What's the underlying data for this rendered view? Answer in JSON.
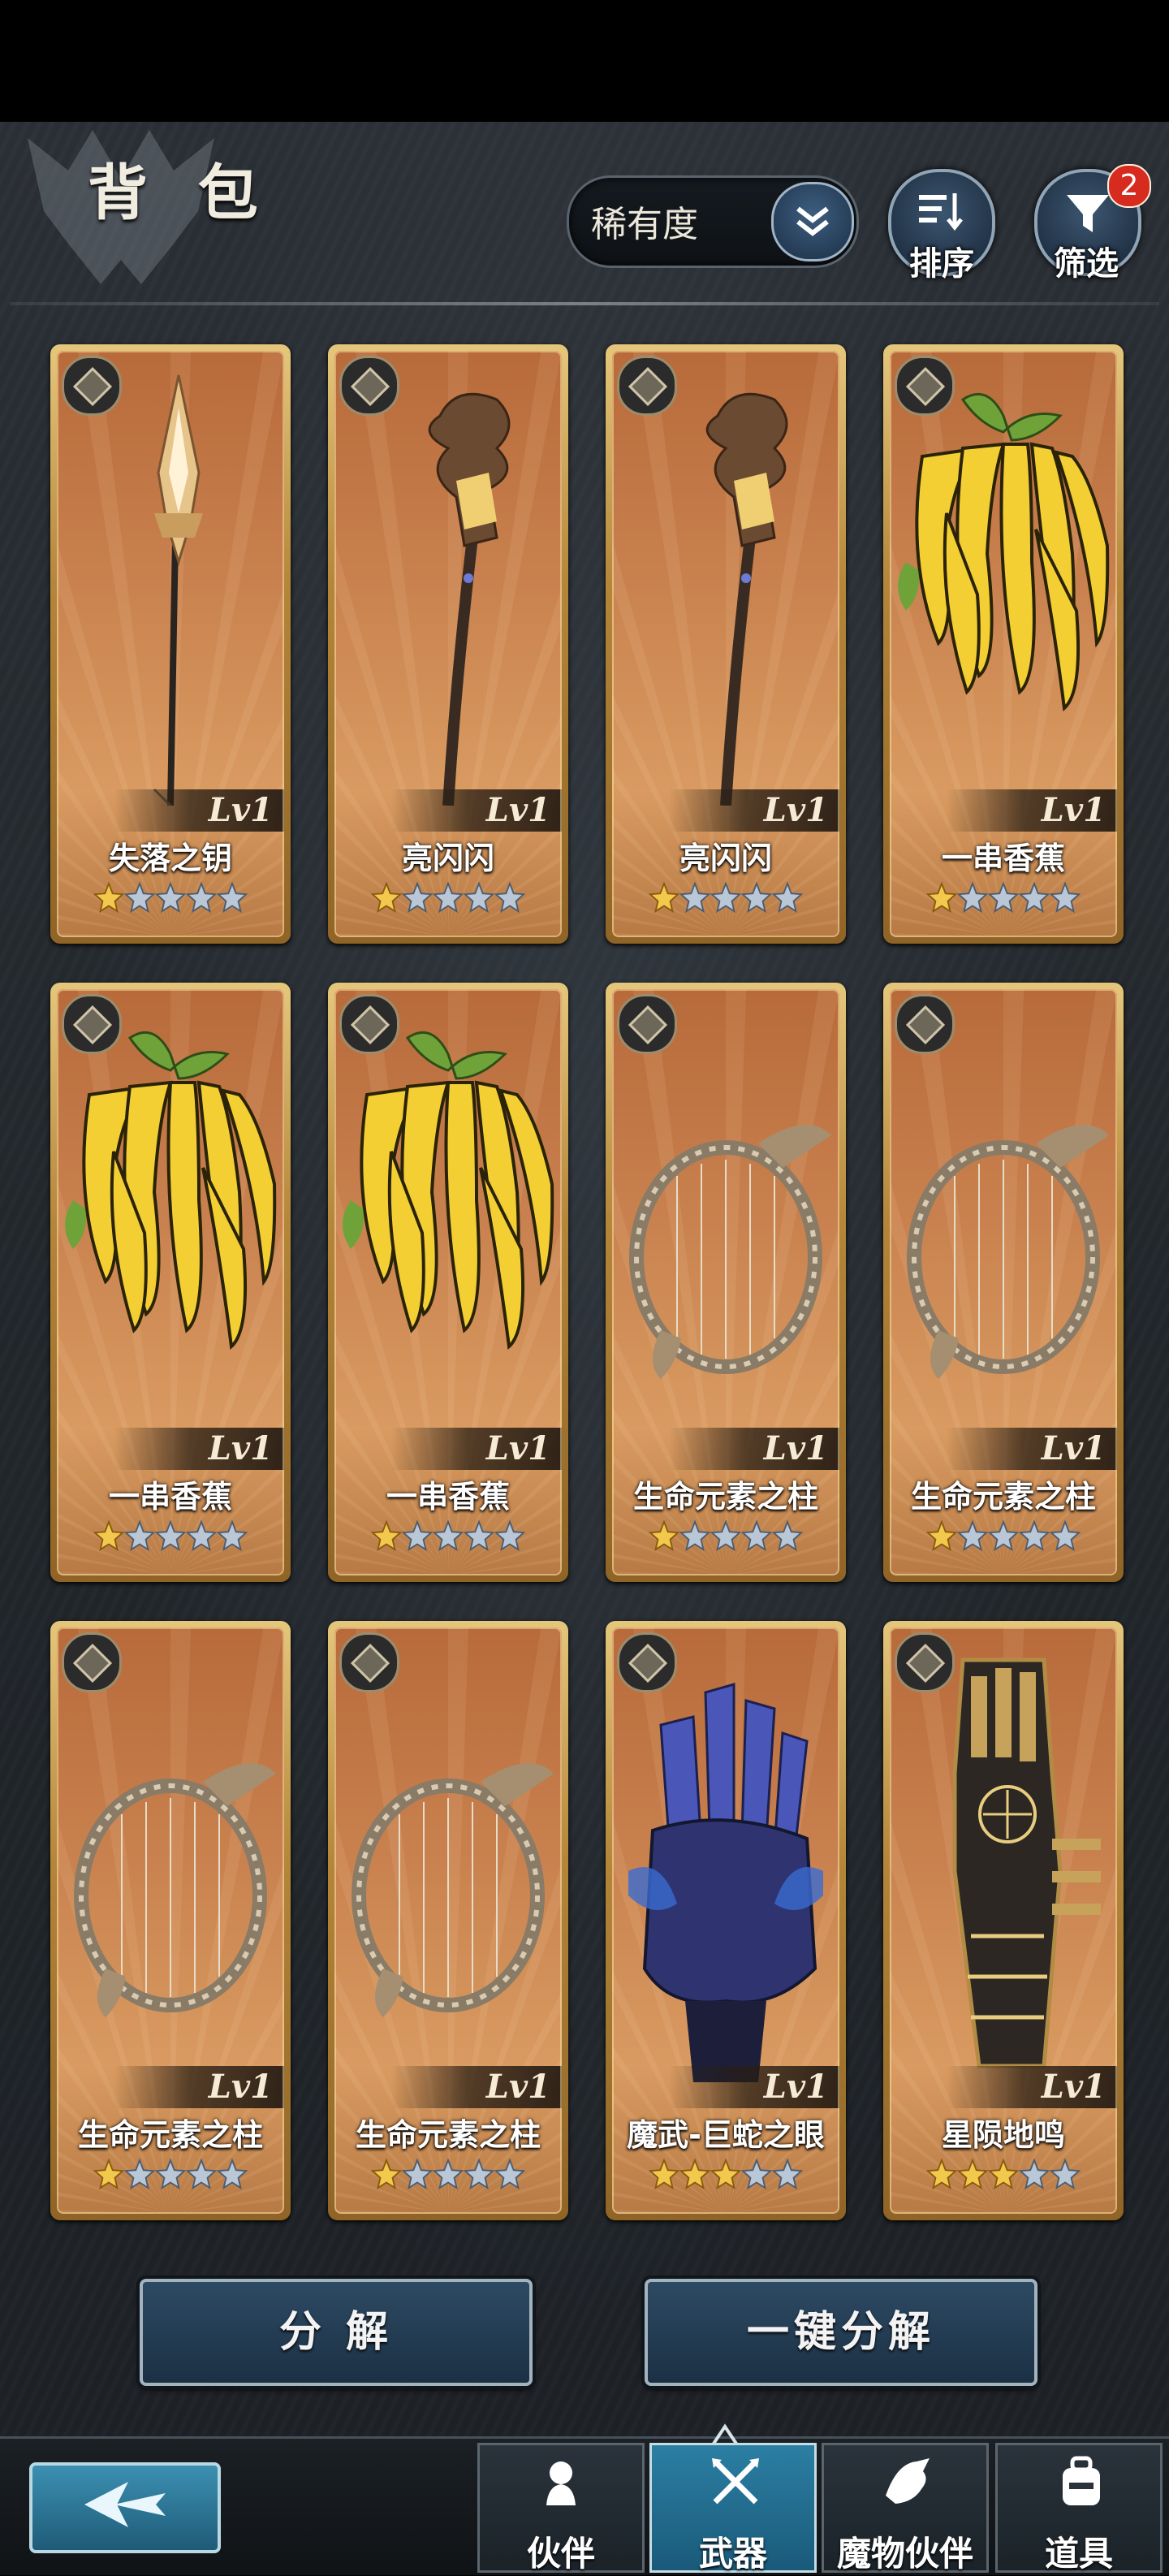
{
  "header": {
    "title": "背 包",
    "rarity_filter": "稀有度",
    "sort_label": "排序",
    "filter_label": "筛选",
    "filter_badge": "2"
  },
  "items": [
    {
      "name": "失落之钥",
      "level": "Lv1",
      "stars": 1,
      "max_stars": 5,
      "art": "spear"
    },
    {
      "name": "亮闪闪",
      "level": "Lv1",
      "stars": 1,
      "max_stars": 5,
      "art": "staff"
    },
    {
      "name": "亮闪闪",
      "level": "Lv1",
      "stars": 1,
      "max_stars": 5,
      "art": "staff"
    },
    {
      "name": "一串香蕉",
      "level": "Lv1",
      "stars": 1,
      "max_stars": 5,
      "art": "banana"
    },
    {
      "name": "一串香蕉",
      "level": "Lv1",
      "stars": 1,
      "max_stars": 5,
      "art": "banana"
    },
    {
      "name": "一串香蕉",
      "level": "Lv1",
      "stars": 1,
      "max_stars": 5,
      "art": "banana"
    },
    {
      "name": "生命元素之柱",
      "level": "Lv1",
      "stars": 1,
      "max_stars": 5,
      "art": "harp"
    },
    {
      "name": "生命元素之柱",
      "level": "Lv1",
      "stars": 1,
      "max_stars": 5,
      "art": "harp"
    },
    {
      "name": "生命元素之柱",
      "level": "Lv1",
      "stars": 1,
      "max_stars": 5,
      "art": "harp"
    },
    {
      "name": "生命元素之柱",
      "level": "Lv1",
      "stars": 1,
      "max_stars": 5,
      "art": "harp"
    },
    {
      "name": "魔武-巨蛇之眼",
      "level": "Lv1",
      "stars": 3,
      "max_stars": 5,
      "art": "claw"
    },
    {
      "name": "星陨地鸣",
      "level": "Lv1",
      "stars": 3,
      "max_stars": 5,
      "art": "gauntlet"
    }
  ],
  "actions": {
    "decompose": "分 解",
    "decompose_all": "一键分解"
  },
  "nav": {
    "tabs": [
      {
        "label": "伙伴",
        "icon": "partner-icon",
        "active": false
      },
      {
        "label": "武器",
        "icon": "weapon-icon",
        "active": true
      },
      {
        "label": "魔物伙伴",
        "icon": "monster-icon",
        "active": false
      },
      {
        "label": "道具",
        "icon": "backpack-icon",
        "active": false
      }
    ]
  },
  "colors": {
    "card_gold": "#d9b56b",
    "card_bg": "#c9824f",
    "star_gold": "#f2c94c",
    "star_silver": "#b9c7d6",
    "active_tab": "#2b7fa3",
    "badge": "#d62b1e"
  }
}
